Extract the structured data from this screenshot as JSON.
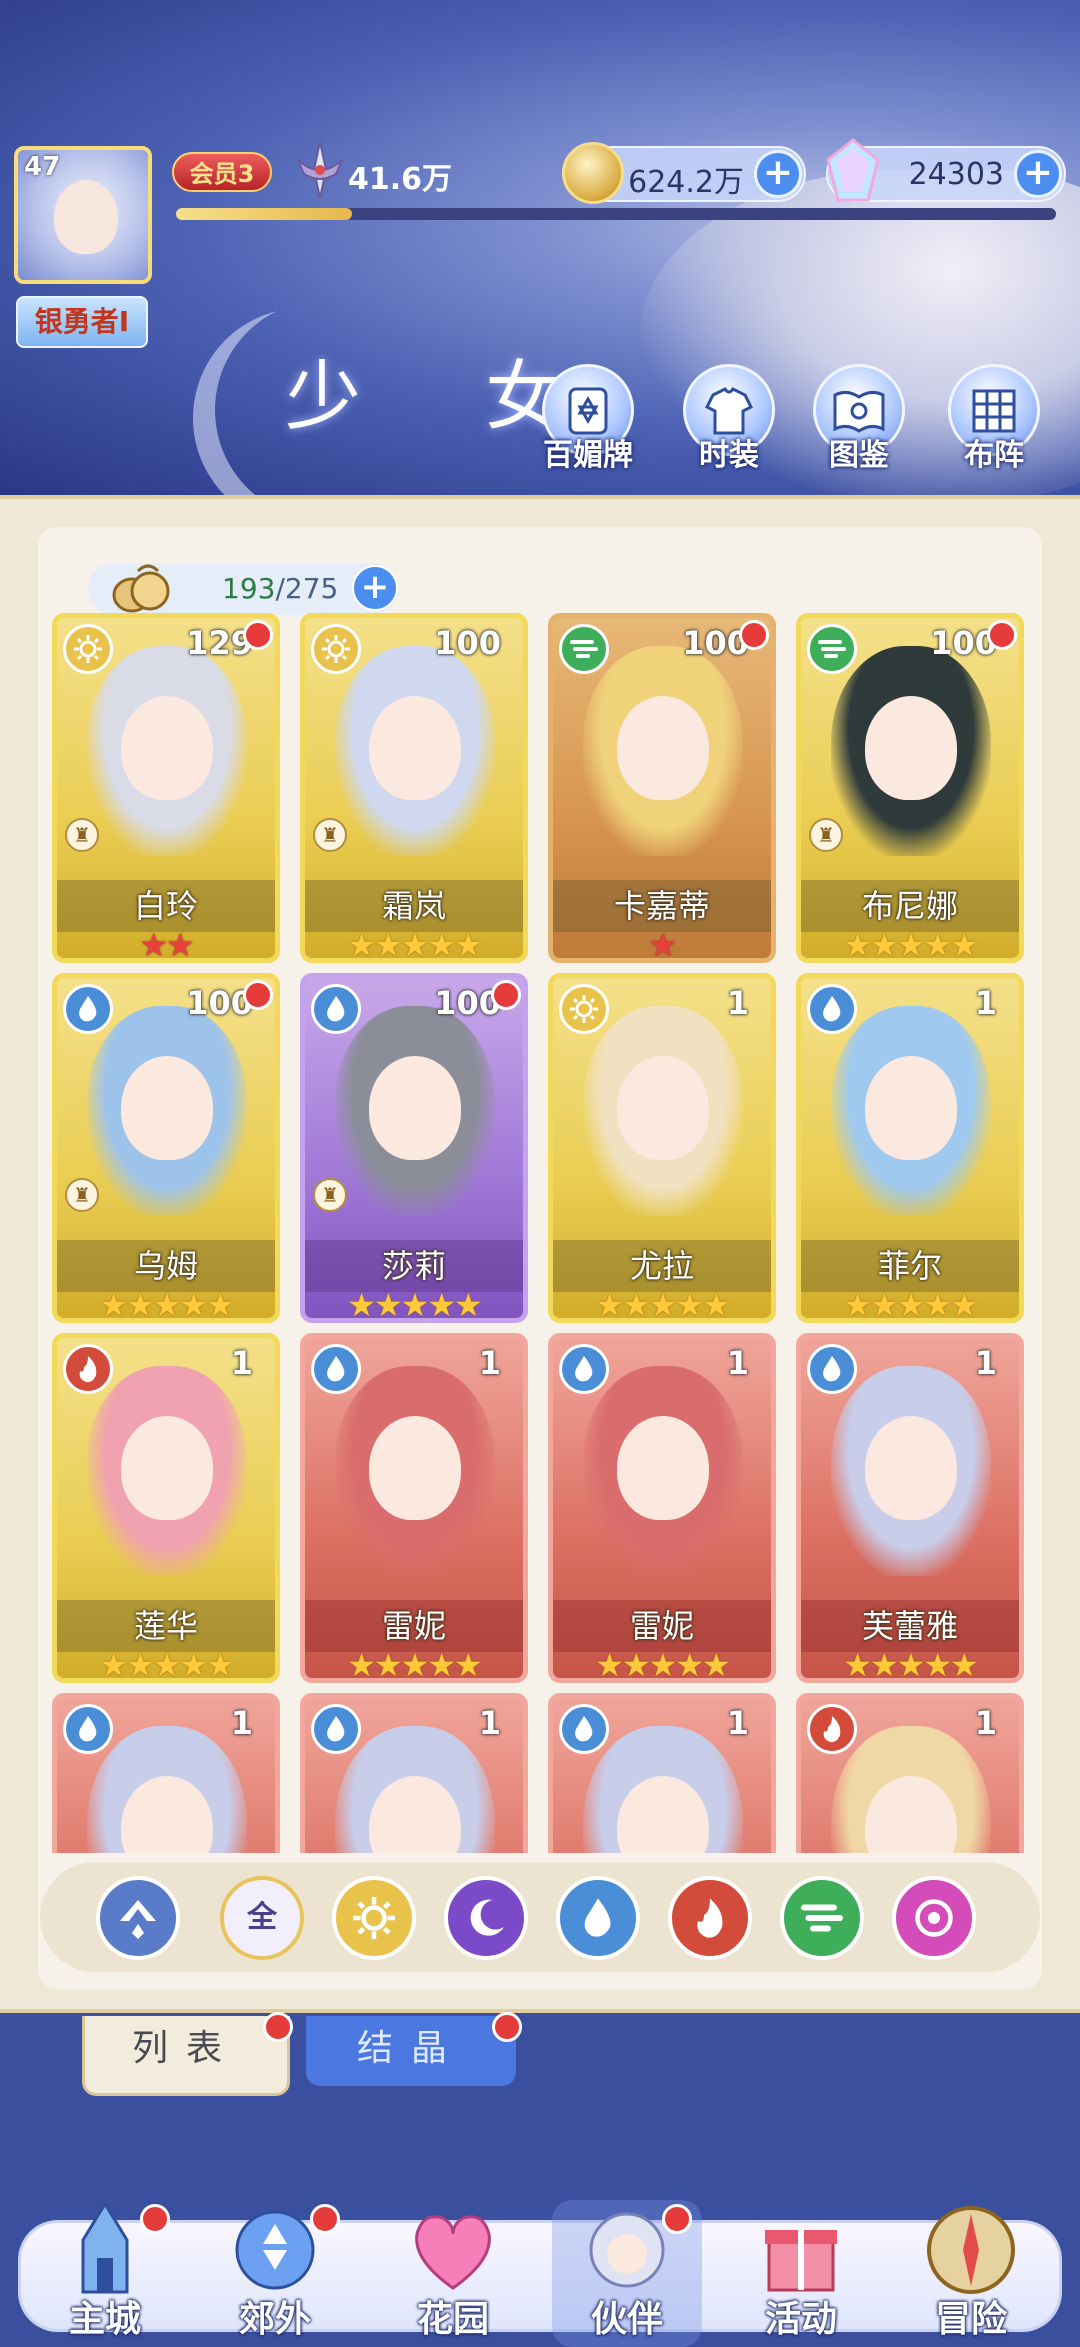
{
  "player": {
    "level": "47",
    "rank": "银勇者Ⅰ",
    "vip": "会员3",
    "power": "41.6万",
    "power_progress": 0.2
  },
  "currency": {
    "coins": "624.2万",
    "crystals": "24303"
  },
  "page": {
    "title": "少 女"
  },
  "menu": [
    {
      "label": "百媚牌",
      "icon": "card-icon"
    },
    {
      "label": "时装",
      "icon": "outfit-icon"
    },
    {
      "label": "图鉴",
      "icon": "book-icon"
    },
    {
      "label": "布阵",
      "icon": "formation-icon"
    }
  ],
  "roster": {
    "owned": "193",
    "capacity": "/275"
  },
  "cards": [
    {
      "name": "白玲",
      "level": "129",
      "element": "light",
      "frame": "gold",
      "stars": 2,
      "star_color": "red",
      "role": true,
      "dot": true
    },
    {
      "name": "霜岚",
      "level": "100",
      "element": "light",
      "frame": "gold",
      "stars": 5,
      "star_color": "gold",
      "role": true,
      "dot": false
    },
    {
      "name": "卡嘉蒂",
      "level": "100",
      "element": "wind",
      "frame": "orange",
      "stars": 1,
      "star_color": "red",
      "role": false,
      "dot": true
    },
    {
      "name": "布尼娜",
      "level": "100",
      "element": "wind",
      "frame": "gold",
      "stars": 5,
      "star_color": "gold",
      "role": true,
      "dot": true
    },
    {
      "name": "乌姆",
      "level": "100",
      "element": "water",
      "frame": "gold",
      "stars": 5,
      "star_color": "gold",
      "role": true,
      "dot": true
    },
    {
      "name": "莎莉",
      "level": "100",
      "element": "water",
      "frame": "purple",
      "stars": 5,
      "star_color": "gold",
      "role": true,
      "dot": true
    },
    {
      "name": "尤拉",
      "level": "1",
      "element": "light",
      "frame": "gold",
      "stars": 5,
      "star_color": "gold",
      "role": false,
      "dot": false
    },
    {
      "name": "菲尔",
      "level": "1",
      "element": "water",
      "frame": "gold",
      "stars": 5,
      "star_color": "gold",
      "role": false,
      "dot": false
    },
    {
      "name": "莲华",
      "level": "1",
      "element": "fire",
      "frame": "gold",
      "stars": 5,
      "star_color": "gold",
      "role": false,
      "dot": false
    },
    {
      "name": "雷妮",
      "level": "1",
      "element": "water",
      "frame": "red",
      "stars": 5,
      "star_color": "gold",
      "role": false,
      "dot": false
    },
    {
      "name": "雷妮",
      "level": "1",
      "element": "water",
      "frame": "red",
      "stars": 5,
      "star_color": "gold",
      "role": false,
      "dot": false
    },
    {
      "name": "芙蕾雅",
      "level": "1",
      "element": "water",
      "frame": "red",
      "stars": 5,
      "star_color": "gold",
      "role": false,
      "dot": false
    },
    {
      "name": "",
      "level": "1",
      "element": "water",
      "frame": "red",
      "stars": 0,
      "star_color": "gold",
      "role": false,
      "dot": false
    },
    {
      "name": "",
      "level": "1",
      "element": "water",
      "frame": "red",
      "stars": 0,
      "star_color": "gold",
      "role": false,
      "dot": false
    },
    {
      "name": "",
      "level": "1",
      "element": "water",
      "frame": "red",
      "stars": 0,
      "star_color": "gold",
      "role": false,
      "dot": false
    },
    {
      "name": "",
      "level": "1",
      "element": "fire",
      "frame": "red",
      "stars": 0,
      "star_color": "gold",
      "role": false,
      "dot": false
    }
  ],
  "filters": [
    {
      "id": "sort",
      "label": ""
    },
    {
      "id": "all",
      "label": "全"
    },
    {
      "id": "light",
      "label": ""
    },
    {
      "id": "dark",
      "label": ""
    },
    {
      "id": "water",
      "label": ""
    },
    {
      "id": "fire",
      "label": ""
    },
    {
      "id": "wind",
      "label": ""
    },
    {
      "id": "arcane",
      "label": ""
    }
  ],
  "tabs": {
    "list": "列表",
    "crystal": "结晶"
  },
  "nav": [
    {
      "label": "主城",
      "dot": true
    },
    {
      "label": "郊外",
      "dot": true
    },
    {
      "label": "花园",
      "dot": false
    },
    {
      "label": "伙伴",
      "dot": true
    },
    {
      "label": "活动",
      "dot": false
    },
    {
      "label": "冒险",
      "dot": false
    }
  ],
  "colors": {
    "accent_blue": "#4b8ef0",
    "notify_red": "#e53b3b",
    "star_gold": "#ffc93a",
    "star_red": "#e8413c"
  }
}
